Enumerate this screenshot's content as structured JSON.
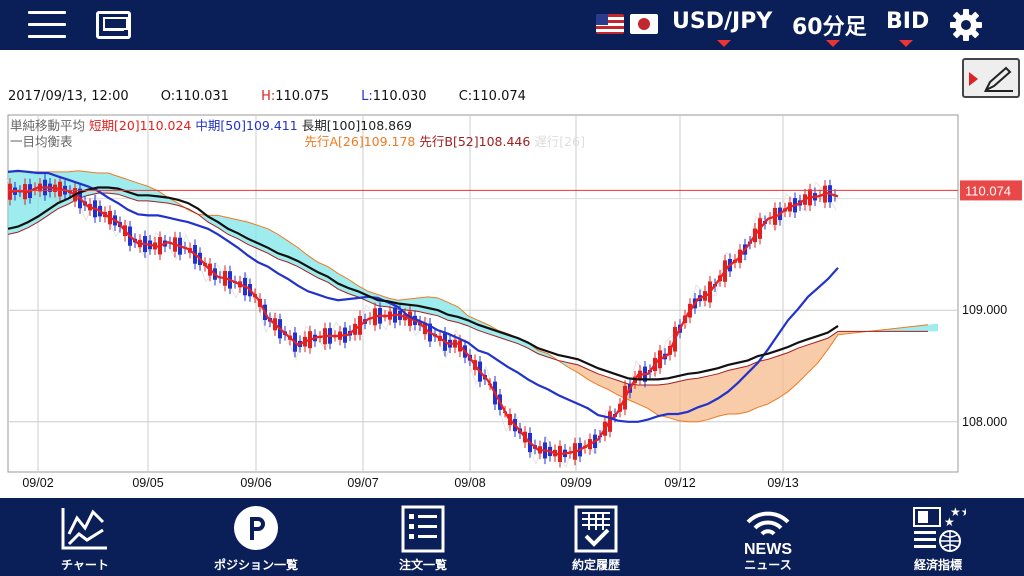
{
  "header": {
    "pair": "USD/JPY",
    "timeframe": "60分足",
    "side": "BID"
  },
  "quote": {
    "datetime": "2017/09/13, 12:00",
    "open": "O:110.031",
    "high_prefix": "H:",
    "high": "110.075",
    "low_prefix": "L:",
    "low": "110.030",
    "close": "C:110.074"
  },
  "legend": {
    "sma_title": "単純移動平均",
    "sma_short": "短期[20]110.024",
    "sma_mid": "中期[50]109.411",
    "sma_long": "長期[100]108.869",
    "ichimoku_title": "一目均衡表",
    "span_a": "先行A[26]109.178",
    "span_b": "先行B[52]108.446",
    "lagging": "遅行[26]"
  },
  "price_label": "110.074",
  "colors": {
    "nav_bg": "#0a1e57",
    "accent_red": "#e33333",
    "sma_short": "#e82020",
    "sma_mid": "#2233cc",
    "sma_long": "#111111",
    "span_a": "#f07a20",
    "span_b": "#a02020",
    "cloud_up": "#7fe6ea",
    "cloud_down": "#f6b98c"
  },
  "chart_data": {
    "type": "line",
    "title": "",
    "y_ticks": [
      "109.000",
      "108.000"
    ],
    "ylim": [
      107.55,
      110.75
    ],
    "x_ticks": [
      "09/02",
      "09/05",
      "09/06",
      "09/07",
      "09/08",
      "09/09",
      "09/12",
      "09/13"
    ],
    "grid": true,
    "current_price": 110.074,
    "series": [
      {
        "name": "短期[20]",
        "x": [
          0,
          10,
          20,
          30,
          40,
          50,
          60,
          70,
          80,
          90,
          100,
          110,
          120,
          130,
          140,
          150,
          160,
          170,
          180,
          190,
          200,
          210,
          220,
          230,
          240,
          250,
          260,
          270,
          280,
          290,
          300,
          310,
          320,
          330,
          340,
          350,
          360,
          370,
          380,
          390,
          400,
          410,
          420,
          430,
          440,
          450,
          460,
          470,
          480,
          490,
          500,
          510,
          520,
          530,
          540,
          550,
          560,
          570,
          580,
          590,
          600,
          610,
          620,
          630,
          640,
          650,
          660,
          670,
          680,
          690,
          700,
          710,
          720,
          730,
          740,
          750,
          760,
          770,
          780,
          790,
          800,
          810,
          820,
          830
        ],
        "values": [
          110.06,
          110.07,
          110.06,
          110.1,
          110.1,
          110.09,
          110.07,
          110.02,
          109.93,
          109.9,
          109.84,
          109.79,
          109.68,
          109.6,
          109.59,
          109.57,
          109.61,
          109.58,
          109.55,
          109.48,
          109.38,
          109.3,
          109.28,
          109.24,
          109.2,
          109.1,
          108.93,
          108.85,
          108.77,
          108.69,
          108.73,
          108.76,
          108.77,
          108.77,
          108.78,
          108.85,
          108.92,
          108.95,
          108.95,
          108.96,
          108.93,
          108.9,
          108.81,
          108.76,
          108.7,
          108.7,
          108.6,
          108.47,
          108.37,
          108.21,
          108.04,
          107.94,
          107.83,
          107.75,
          107.74,
          107.71,
          107.72,
          107.74,
          107.79,
          107.84,
          107.98,
          108.09,
          108.27,
          108.42,
          108.43,
          108.55,
          108.6,
          108.8,
          108.97,
          109.1,
          109.14,
          109.26,
          109.39,
          109.46,
          109.58,
          109.71,
          109.82,
          109.85,
          109.92,
          109.95,
          110.01,
          110.02,
          110.05,
          110.02
        ]
      },
      {
        "name": "中期[50]",
        "x": [
          0,
          10,
          20,
          30,
          40,
          50,
          60,
          70,
          80,
          90,
          100,
          110,
          120,
          130,
          140,
          150,
          160,
          170,
          180,
          190,
          200,
          210,
          220,
          230,
          240,
          250,
          260,
          270,
          280,
          290,
          300,
          310,
          320,
          330,
          340,
          350,
          360,
          370,
          380,
          390,
          400,
          410,
          420,
          430,
          440,
          450,
          460,
          470,
          480,
          490,
          500,
          510,
          520,
          530,
          540,
          550,
          560,
          570,
          580,
          590,
          600,
          610,
          620,
          630,
          640,
          650,
          660,
          670,
          680,
          690,
          700,
          710,
          720,
          730,
          740,
          750,
          760,
          770,
          780,
          790,
          800,
          810,
          820,
          830
        ],
        "values": [
          110.24,
          110.25,
          110.24,
          110.23,
          110.23,
          110.2,
          110.17,
          110.14,
          110.11,
          110.07,
          110.01,
          109.96,
          109.9,
          109.86,
          109.85,
          109.85,
          109.83,
          109.81,
          109.79,
          109.76,
          109.73,
          109.68,
          109.62,
          109.56,
          109.49,
          109.43,
          109.39,
          109.33,
          109.28,
          109.22,
          109.17,
          109.14,
          109.11,
          109.09,
          109.1,
          109.11,
          109.12,
          109.11,
          109.07,
          109.03,
          108.95,
          108.91,
          108.87,
          108.82,
          108.79,
          108.75,
          108.71,
          108.64,
          108.61,
          108.55,
          108.49,
          108.44,
          108.38,
          108.33,
          108.29,
          108.24,
          108.2,
          108.16,
          108.12,
          108.06,
          108.04,
          108.01,
          108.0,
          108.0,
          108.02,
          108.05,
          108.07,
          108.07,
          108.09,
          108.13,
          108.16,
          108.21,
          108.27,
          108.35,
          108.44,
          108.53,
          108.65,
          108.78,
          108.91,
          109.01,
          109.12,
          109.2,
          109.28,
          109.38
        ]
      },
      {
        "name": "長期[100]",
        "x": [
          0,
          10,
          20,
          30,
          40,
          50,
          60,
          70,
          80,
          90,
          100,
          110,
          120,
          130,
          140,
          150,
          160,
          170,
          180,
          190,
          200,
          210,
          220,
          230,
          240,
          250,
          260,
          270,
          280,
          290,
          300,
          310,
          320,
          330,
          340,
          350,
          360,
          370,
          380,
          390,
          400,
          410,
          420,
          430,
          440,
          450,
          460,
          470,
          480,
          490,
          500,
          510,
          520,
          530,
          540,
          550,
          560,
          570,
          580,
          590,
          600,
          610,
          620,
          630,
          640,
          650,
          660,
          670,
          680,
          690,
          700,
          710,
          720,
          730,
          740,
          750,
          760,
          770,
          780,
          790,
          800,
          810,
          820,
          830
        ],
        "values": [
          109.73,
          109.75,
          109.79,
          109.84,
          109.9,
          109.96,
          110.0,
          110.05,
          110.08,
          110.1,
          110.1,
          110.09,
          110.06,
          110.03,
          110.03,
          110.02,
          110.01,
          109.99,
          109.96,
          109.91,
          109.84,
          109.79,
          109.73,
          109.69,
          109.64,
          109.6,
          109.56,
          109.51,
          109.48,
          109.44,
          109.39,
          109.34,
          109.3,
          109.24,
          109.2,
          109.17,
          109.13,
          109.09,
          109.08,
          109.06,
          109.05,
          109.04,
          109.02,
          109.0,
          108.96,
          108.94,
          108.91,
          108.87,
          108.84,
          108.81,
          108.78,
          108.75,
          108.71,
          108.66,
          108.63,
          108.6,
          108.58,
          108.56,
          108.52,
          108.48,
          108.45,
          108.42,
          108.39,
          108.38,
          108.38,
          108.38,
          108.39,
          108.41,
          108.43,
          108.44,
          108.46,
          108.48,
          108.51,
          108.53,
          108.55,
          108.59,
          108.61,
          108.64,
          108.67,
          108.71,
          108.74,
          108.77,
          108.8,
          108.86
        ]
      }
    ]
  },
  "nav": [
    {
      "icon": "chart-icon",
      "label": "チャート"
    },
    {
      "icon": "position-icon",
      "label": "ポジション一覧"
    },
    {
      "icon": "order-icon",
      "label": "注文一覧"
    },
    {
      "icon": "history-icon",
      "label": "約定履歴"
    },
    {
      "icon": "news-icon",
      "label": "ニュース",
      "icon_text": "NEWS"
    },
    {
      "icon": "economic-icon",
      "label": "経済指標"
    }
  ]
}
